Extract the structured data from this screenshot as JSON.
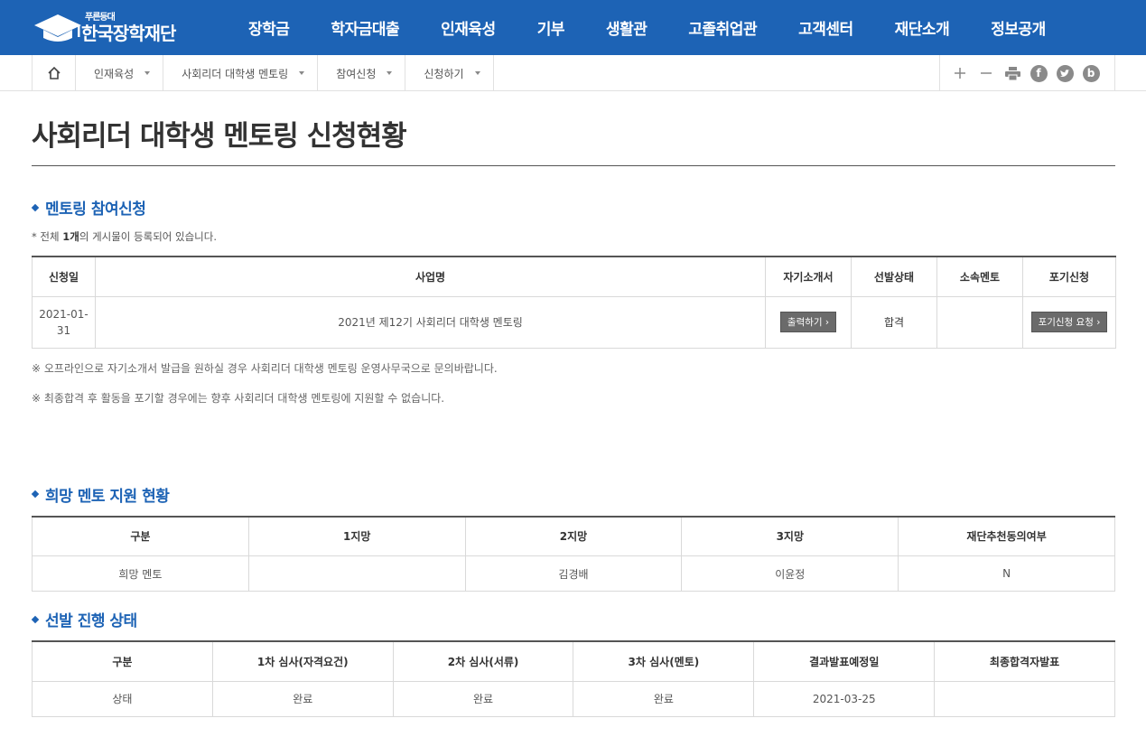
{
  "header": {
    "logo_small": "푸른등대",
    "logo_text": "한국장학재단",
    "menu": [
      "장학금",
      "학자금대출",
      "인재육성",
      "기부",
      "생활관",
      "고졸취업관",
      "고객센터",
      "재단소개",
      "정보공개"
    ]
  },
  "breadcrumb": [
    "인재육성",
    "사회리더 대학생 멘토링",
    "참여신청",
    "신청하기"
  ],
  "page_title": "사회리더 대학생 멘토링 신청현황",
  "section1": {
    "title": "멘토링 참여신청",
    "count_prefix": "* 전체 ",
    "count_value": "1개",
    "count_suffix": "의 게시물이 등록되어 있습니다.",
    "columns": [
      "신청일",
      "사업명",
      "자기소개서",
      "선발상태",
      "소속멘토",
      "포기신청"
    ],
    "row": {
      "date_line1": "2021-01-",
      "date_line2": "31",
      "program": "2021년 제12기 사회리더 대학생 멘토링",
      "print_button": "출력하기",
      "status": "합격",
      "mentor": "",
      "giveup_button": "포기신청 요청"
    },
    "notes": [
      "※ 오프라인으로 자기소개서 발급을 원하실 경우 사회리더 대학생 멘토링 운영사무국으로 문의바랍니다.",
      "※ 최종합격 후 활동을 포기할 경우에는 향후 사회리더 대학생 멘토링에 지원할 수 없습니다."
    ]
  },
  "section2": {
    "title": "희망 멘토 지원 현황",
    "columns": [
      "구분",
      "1지망",
      "2지망",
      "3지망",
      "재단추천동의여부"
    ],
    "row": [
      "희망 멘토",
      "",
      "김경배",
      "이윤정",
      "N"
    ]
  },
  "section3": {
    "title": "선발 진행 상태",
    "columns": [
      "구분",
      "1차 심사(자격요건)",
      "2차 심사(서류)",
      "3차 심사(멘토)",
      "결과발표예정일",
      "최종합격자발표"
    ],
    "row": [
      "상태",
      "완료",
      "완료",
      "완료",
      "2021-03-25",
      ""
    ]
  },
  "icons": {
    "home": "home-icon",
    "zoom_in": "plus-icon",
    "zoom_out": "minus-icon",
    "print": "printer-icon",
    "facebook": "facebook-icon",
    "twitter": "twitter-icon",
    "blog": "blog-icon"
  },
  "colors": {
    "brand": "#1d63b5",
    "button": "#6b6b6b"
  }
}
